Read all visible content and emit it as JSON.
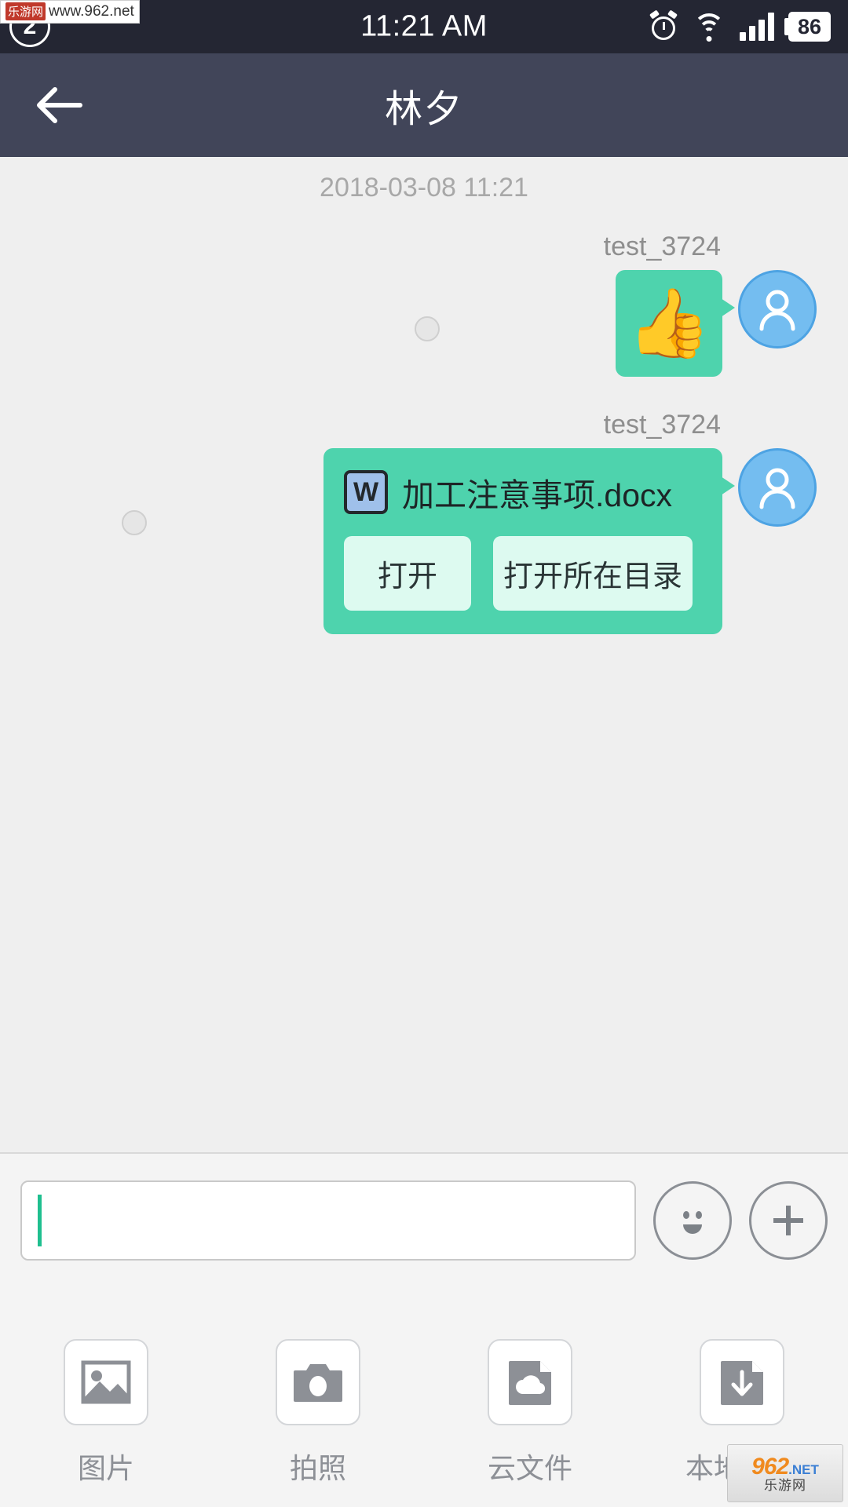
{
  "status_bar": {
    "notification_count": "2",
    "time": "11:21 AM",
    "battery_level": "86",
    "icons": [
      "alarm-icon",
      "wifi-icon",
      "signal-icon",
      "battery-icon"
    ]
  },
  "watermark_top": {
    "site_label": "乐游网",
    "url": "www.962.net"
  },
  "watermark_bottom": {
    "main": "962",
    "net": ".NET",
    "sub": "乐游网"
  },
  "header": {
    "back_icon": "back-arrow-icon",
    "title": "林夕"
  },
  "chat": {
    "date_divider": "2018-03-08 11:21",
    "messages": [
      {
        "sender": "test_3724",
        "type": "emoji",
        "emoji": "👍",
        "emoji_name": "thumbs-up-emoji",
        "avatar_icon": "person-avatar-icon"
      },
      {
        "sender": "test_3724",
        "type": "file",
        "file_icon": "word-doc-icon",
        "file_icon_letter": "W",
        "file_name": "加工注意事项.docx",
        "actions": [
          {
            "label": "打开",
            "name": "open-file-button"
          },
          {
            "label": "打开所在目录",
            "name": "open-directory-button"
          }
        ],
        "avatar_icon": "person-avatar-icon"
      }
    ]
  },
  "input_bar": {
    "text_value": "",
    "placeholder": "",
    "emoji_button": "emoji-smiley-icon",
    "add_button": "plus-icon"
  },
  "attach_panel": {
    "items": [
      {
        "label": "图片",
        "icon": "image-icon",
        "name": "attach-image"
      },
      {
        "label": "拍照",
        "icon": "camera-icon",
        "name": "attach-camera"
      },
      {
        "label": "云文件",
        "icon": "cloud-file-icon",
        "name": "attach-cloud-file"
      },
      {
        "label": "本地文件",
        "icon": "local-file-download-icon",
        "name": "attach-local-file"
      }
    ]
  },
  "colors": {
    "status_bar_bg": "#242633",
    "app_bar_bg": "#414559",
    "chat_bg": "#efefef",
    "bubble_green": "#4ed3ad",
    "bubble_button": "#ddfaf0",
    "avatar_blue": "#74bdf0",
    "caret_teal": "#1fbf8f",
    "muted_text": "#8e8e8e"
  }
}
